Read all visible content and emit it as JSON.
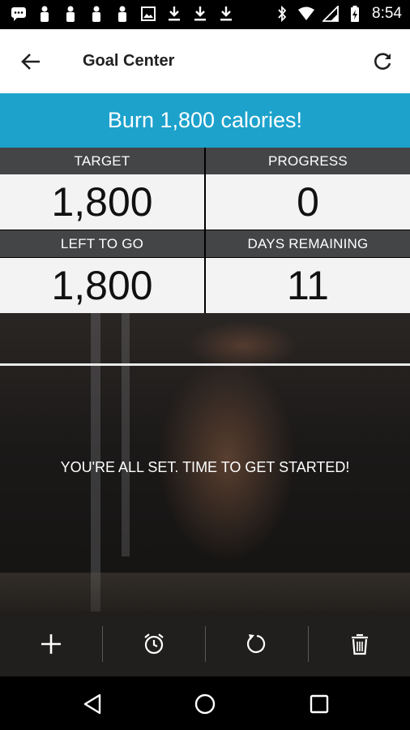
{
  "status_bar": {
    "time": "8:54",
    "left_icons": [
      "message-icon",
      "person-icon",
      "person-icon",
      "person-icon",
      "person-icon",
      "image-icon",
      "download-icon",
      "download-icon",
      "download-icon"
    ],
    "right_icons": [
      "bluetooth-icon",
      "wifi-icon",
      "signal-icon",
      "battery-charging-icon"
    ]
  },
  "app_bar": {
    "title": "Goal Center"
  },
  "goal": {
    "banner": "Burn 1,800 calories!"
  },
  "stats": {
    "target_label": "TARGET",
    "target_value": "1,800",
    "progress_label": "PROGRESS",
    "progress_value": "0",
    "left_label": "LEFT TO GO",
    "left_value": "1,800",
    "days_label": "DAYS REMAINING",
    "days_value": "11"
  },
  "message": "YOU'RE ALL SET. TIME TO GET STARTED!",
  "actions": [
    "add-icon",
    "alarm-icon",
    "reset-icon",
    "delete-icon"
  ],
  "colors": {
    "accent": "#1da2cc",
    "header_bg": "#434547",
    "value_bg": "#f3f3f3",
    "action_bar_bg": "#211f1d"
  }
}
